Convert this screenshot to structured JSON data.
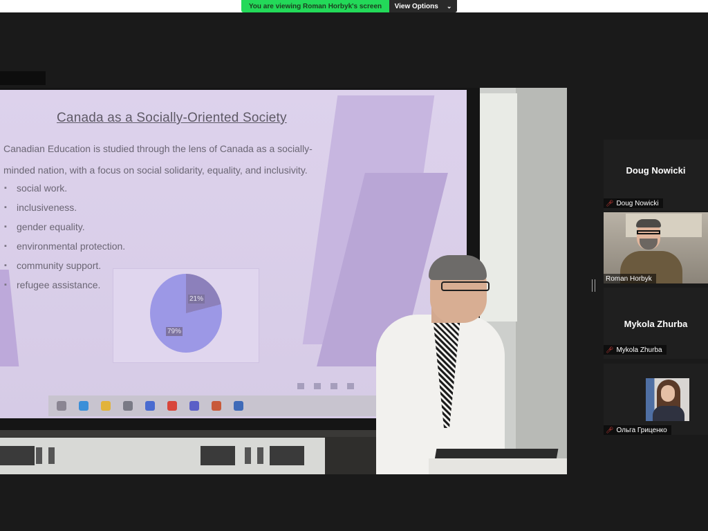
{
  "banner": {
    "viewing_text": "You are viewing Roman Horbyk's screen",
    "view_options_label": "View Options"
  },
  "slide": {
    "title": "Canada as a Socially-Oriented Society",
    "body_line1": "Canadian Education is studied through the lens of Canada as a socially-",
    "body_line2": "minded nation, with a focus on social solidarity, equality, and inclusivity.",
    "bullets": [
      "social work.",
      "inclusiveness.",
      "gender equality.",
      "environmental protection.",
      "community support.",
      "refugee assistance."
    ],
    "pie_labels": [
      "21%",
      "79%"
    ]
  },
  "participants": [
    {
      "name": "Doug Nowicki",
      "label": "Doug Nowicki",
      "muted": true
    },
    {
      "name": "Roman Horbyk",
      "label": "Roman Horbyk",
      "muted": false
    },
    {
      "name": "Mykola Zhurba",
      "label": "Mykola Zhurba",
      "muted": true
    },
    {
      "name": "Ольга Гриценко",
      "label": "Ольга Гриценко",
      "muted": true
    }
  ],
  "colors": {
    "banner_green": "#23d959",
    "muted_red": "#e0403a",
    "background": "#1a1a1a"
  }
}
